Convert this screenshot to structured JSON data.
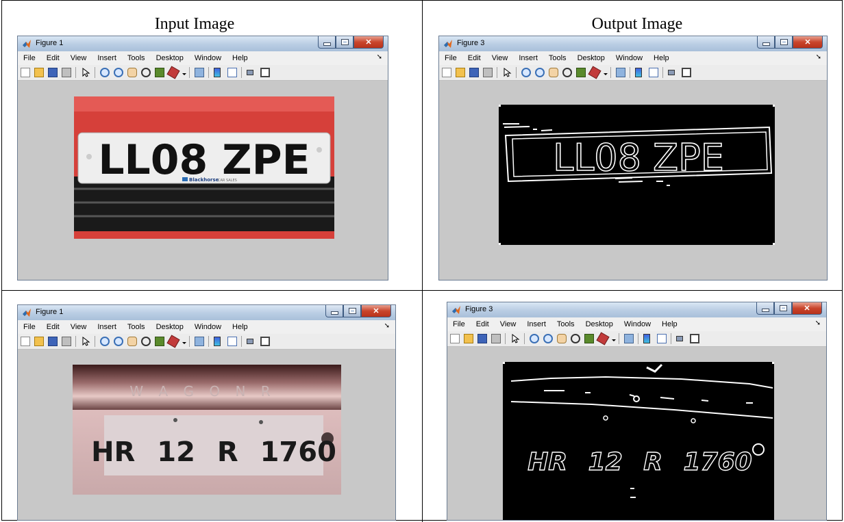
{
  "headings": {
    "input": "Input Image",
    "output": "Output Image"
  },
  "menu": [
    "File",
    "Edit",
    "View",
    "Insert",
    "Tools",
    "Desktop",
    "Window",
    "Help"
  ],
  "windows": [
    {
      "title": "Figure 1",
      "plate": "LL08 ZPE",
      "dealer": "Blackhorse",
      "dealer_sub": "CAR SALES"
    },
    {
      "title": "Figure 3",
      "plate": "LL08 ZPE"
    },
    {
      "title": "Figure 1",
      "brand": "W A G O N R",
      "plate": "HR 12 R 1760"
    },
    {
      "title": "Figure 3",
      "plate": "HR 12 R 1760"
    }
  ],
  "colors": {
    "titlebar": "#b9cde3",
    "figure_bg": "#c8c8c8",
    "close": "#c9452c",
    "car_red": "#d93a34"
  },
  "icons": [
    "new-figure-icon",
    "open-file-icon",
    "save-icon",
    "print-icon",
    "select-arrow-icon",
    "zoom-in-icon",
    "zoom-out-icon",
    "pan-hand-icon",
    "rotate-3d-icon",
    "data-cursor-icon",
    "brush-icon",
    "brush-dropdown-icon",
    "link-plot-icon",
    "colorbar-icon",
    "legend-icon",
    "hide-plot-tools-icon",
    "show-plot-tools-icon"
  ]
}
